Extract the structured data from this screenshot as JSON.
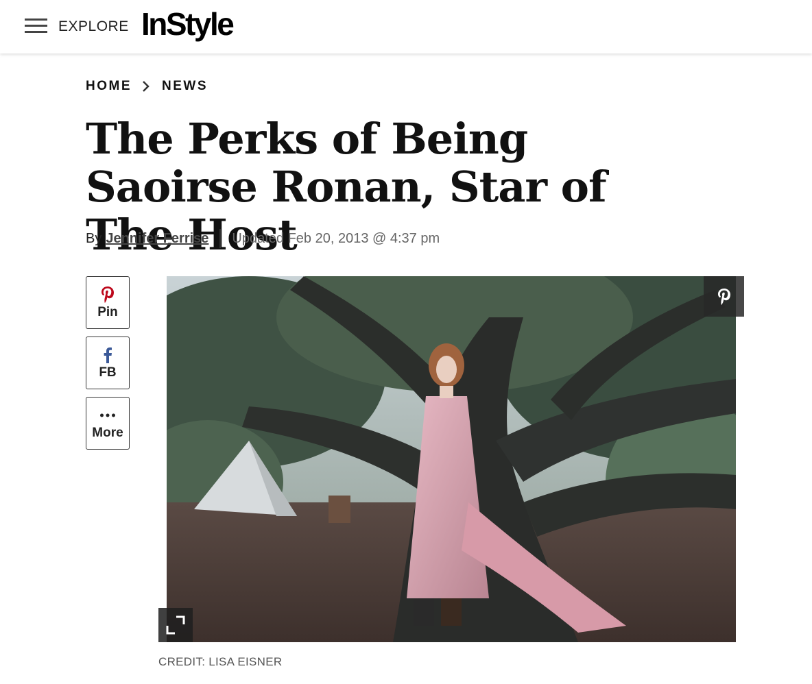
{
  "header": {
    "menu_icon": "hamburger-menu-icon",
    "explore_label": "EXPLORE",
    "logo_text": "InStyle"
  },
  "breadcrumb": {
    "items": [
      "HOME",
      "NEWS"
    ],
    "separator_icon": "chevron-right-icon"
  },
  "article": {
    "title": "The Perks of Being Saoirse Ronan, Star of The Host",
    "by_label": "By",
    "author": "Jennifer Ferrise",
    "updated": "Updated Feb 20, 2013 @ 4:37 pm"
  },
  "share": {
    "pin_label": "Pin",
    "fb_label": "FB",
    "more_label": "More",
    "pin_color": "#bd081c",
    "fb_color": "#3b5998"
  },
  "image": {
    "credit": "CREDIT: LISA EISNER",
    "overlay_icon": "pinterest-icon",
    "expand_icon": "expand-icon"
  }
}
